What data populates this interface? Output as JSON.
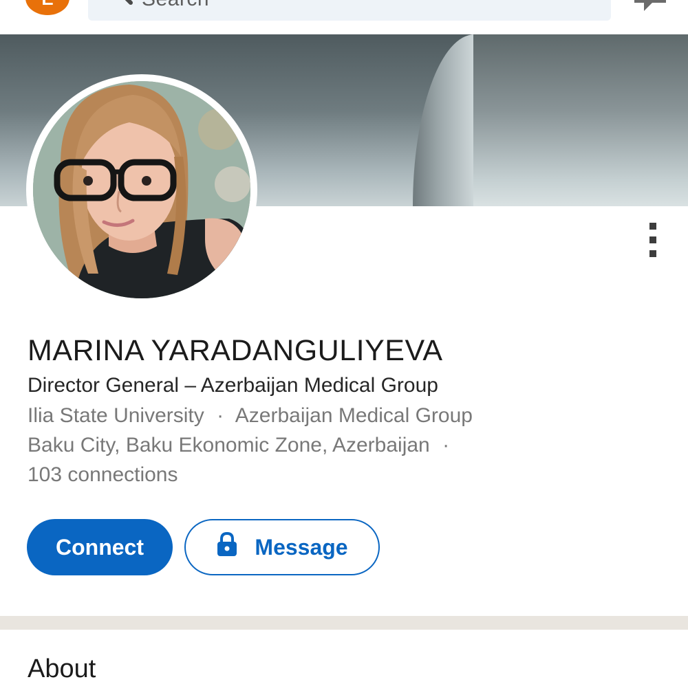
{
  "topbar": {
    "avatar_initial": "E",
    "search_placeholder": "Search"
  },
  "icons": {
    "search": "search-icon",
    "messaging": "messaging-icon",
    "more": "more-vertical-icon",
    "lock": "lock-icon"
  },
  "profile": {
    "name": "MARINA YARADANGULIYEVA",
    "headline": "Director General – Azerbaijan Medical Group",
    "education": "Ilia State University",
    "company": "Azerbaijan Medical Group",
    "location": "Baku City, Baku Ekonomic Zone, Azerbaijan",
    "connections": "103 connections",
    "separator": "·"
  },
  "actions": {
    "connect_label": "Connect",
    "message_label": "Message"
  },
  "about": {
    "title": "About"
  },
  "colors": {
    "accent": "#0a66c2",
    "avatar_bg": "#e8710a",
    "divider": "#e9e5df"
  }
}
